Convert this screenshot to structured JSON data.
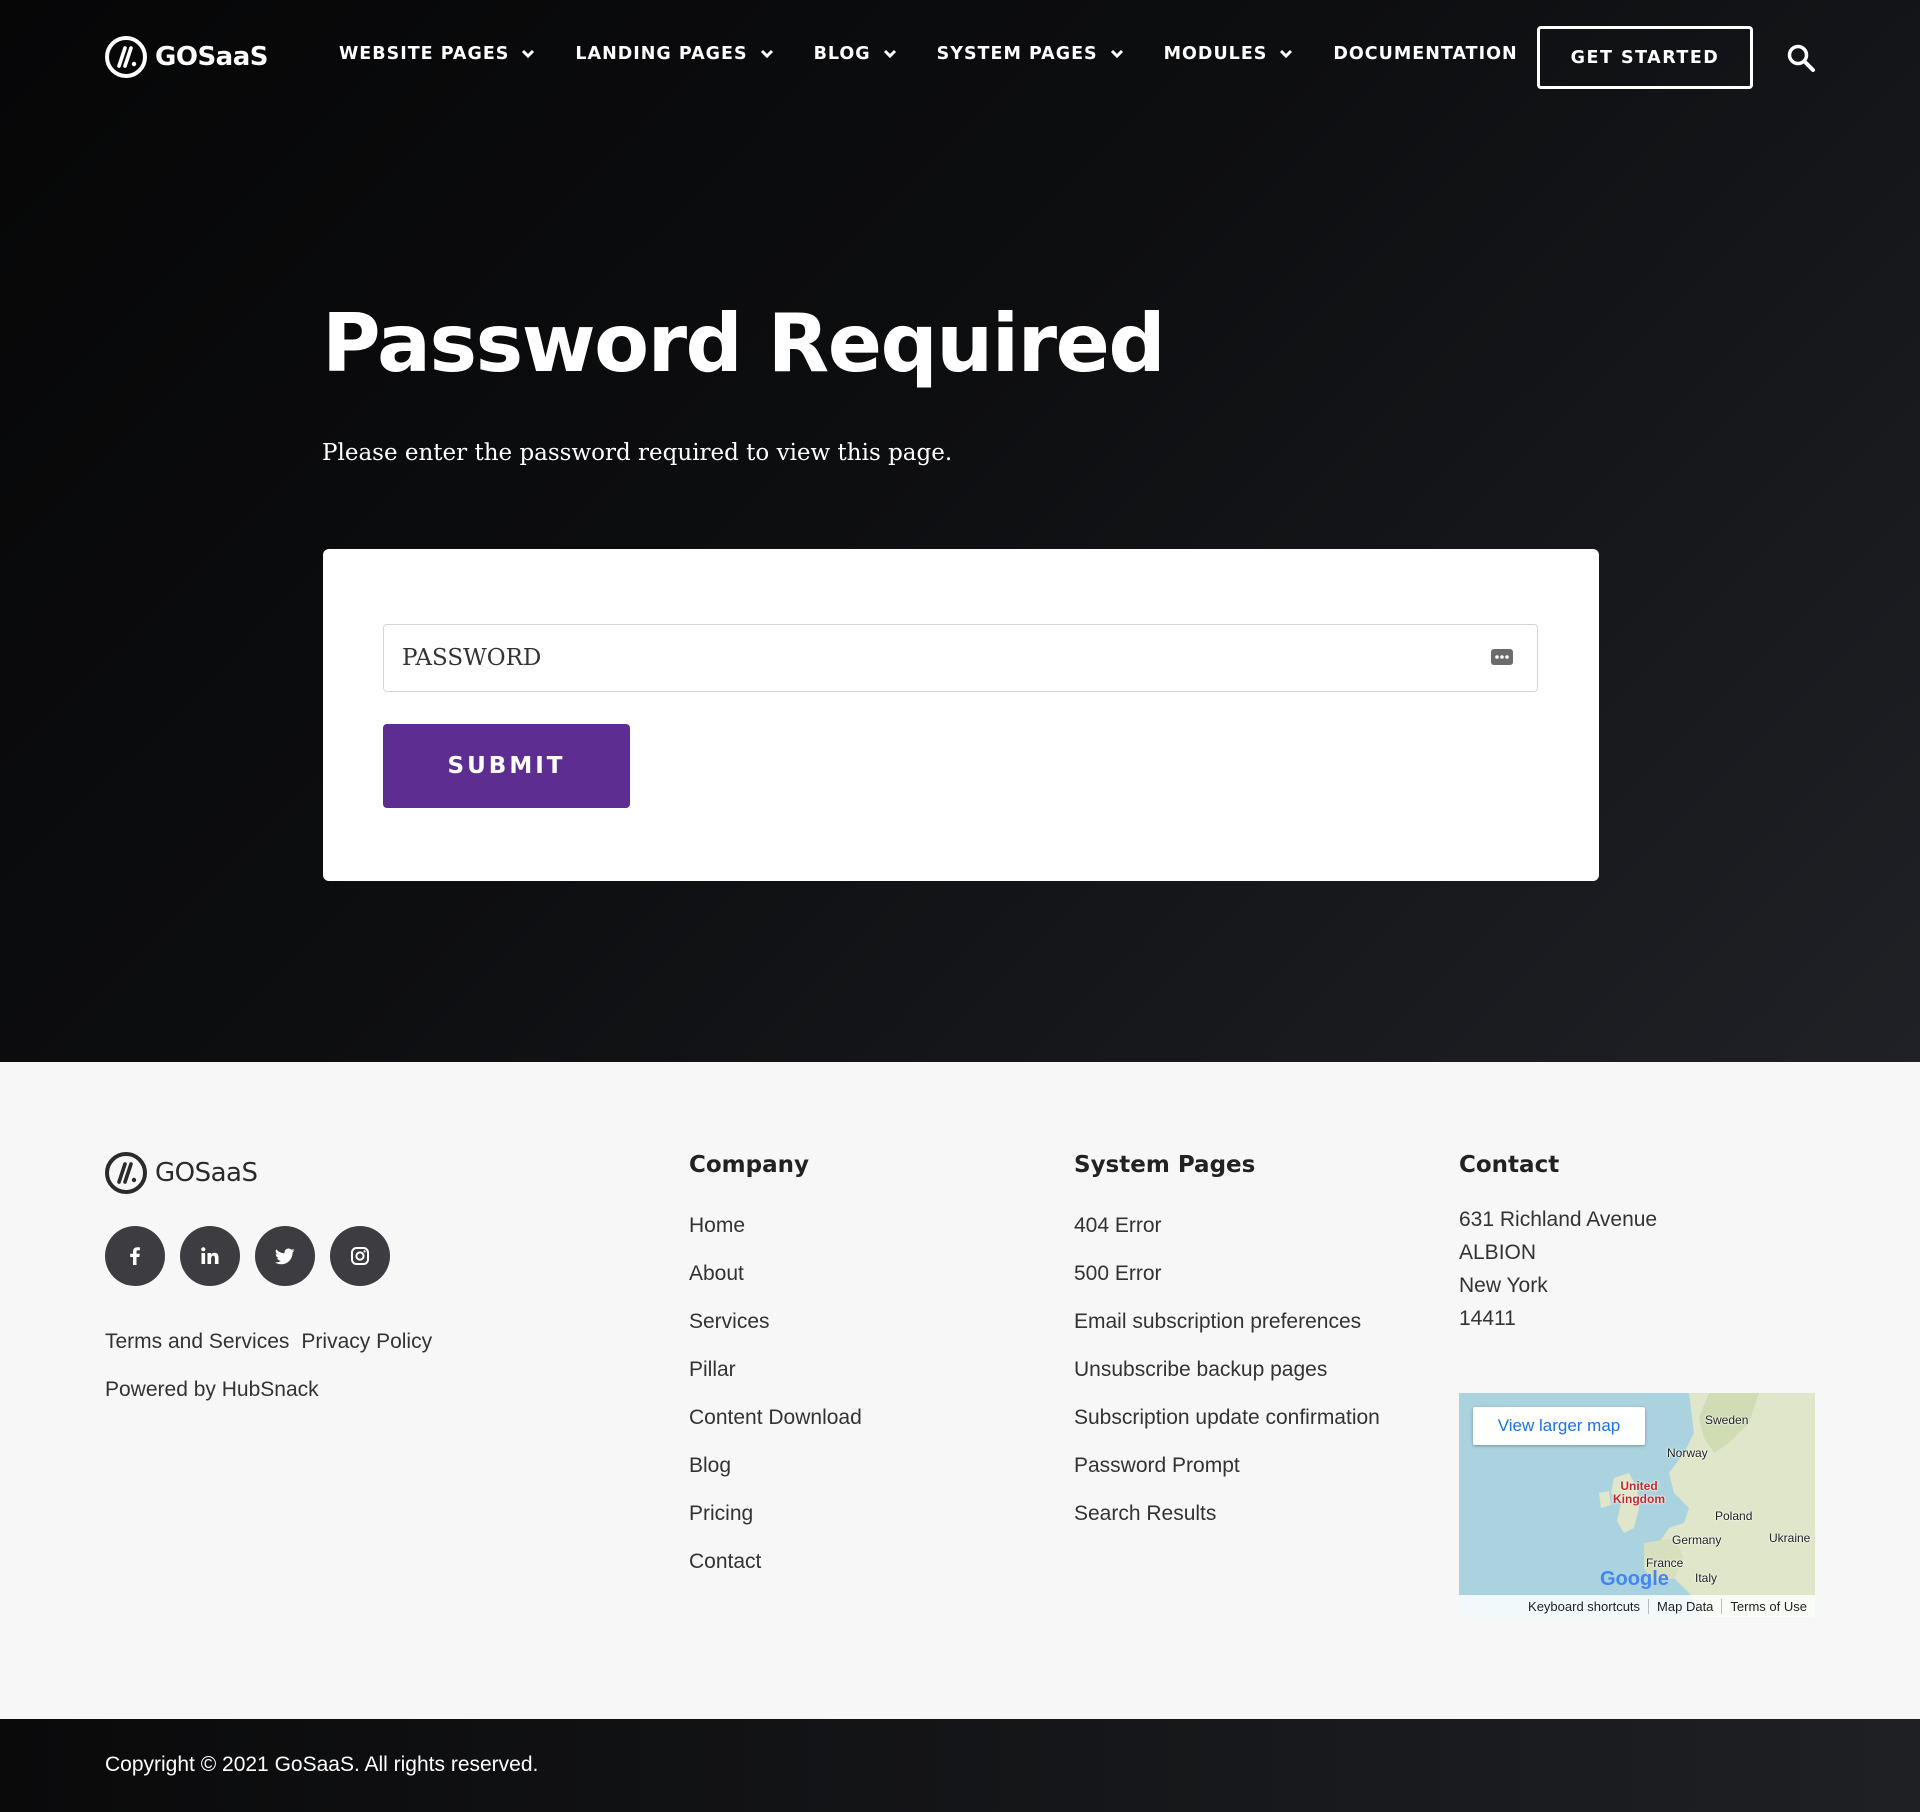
{
  "brand": {
    "name": "GOSaaS"
  },
  "nav": {
    "items": [
      {
        "label": "WEBSITE PAGES",
        "dropdown": true
      },
      {
        "label": "LANDING PAGES",
        "dropdown": true
      },
      {
        "label": "BLOG",
        "dropdown": true
      },
      {
        "label": "SYSTEM PAGES",
        "dropdown": true
      },
      {
        "label": "MODULES",
        "dropdown": true
      },
      {
        "label": "DOCUMENTATION",
        "dropdown": false
      }
    ],
    "cta": "GET STARTED"
  },
  "hero": {
    "title": "Password Required",
    "subtitle": "Please enter the password required to view this page."
  },
  "form": {
    "password_placeholder": "PASSWORD",
    "submit_label": "SUBMIT"
  },
  "footer": {
    "legal": [
      "Terms and Services",
      "Privacy Policy"
    ],
    "powered": "Powered by HubSnack",
    "company": {
      "heading": "Company",
      "links": [
        "Home",
        "About",
        "Services",
        "Pillar",
        "Content Download",
        "Blog",
        "Pricing",
        "Contact"
      ]
    },
    "system": {
      "heading": "System Pages",
      "links": [
        "404 Error",
        "500 Error",
        "Email subscription preferences",
        "Unsubscribe backup pages",
        "Subscription update confirmation",
        "Password Prompt",
        "Search Results"
      ]
    },
    "contact": {
      "heading": "Contact",
      "address": [
        "631 Richland Avenue",
        "ALBION",
        "New York",
        "14411"
      ]
    },
    "map": {
      "button": "View larger map",
      "labels": [
        "Sweden",
        "Norway",
        "United Kingdom",
        "Poland",
        "Germany",
        "Ukraine",
        "France",
        "Italy"
      ],
      "google": "Google",
      "footer_links": [
        "Keyboard shortcuts",
        "Map Data",
        "Terms of Use"
      ]
    }
  },
  "copyright": "Copyright © 2021 GoSaaS. All rights reserved.",
  "colors": {
    "accent": "#5e2d91",
    "dark": "#0b0c0e",
    "footer_bg": "#f7f7f7",
    "social_bg": "#3c3c41"
  }
}
